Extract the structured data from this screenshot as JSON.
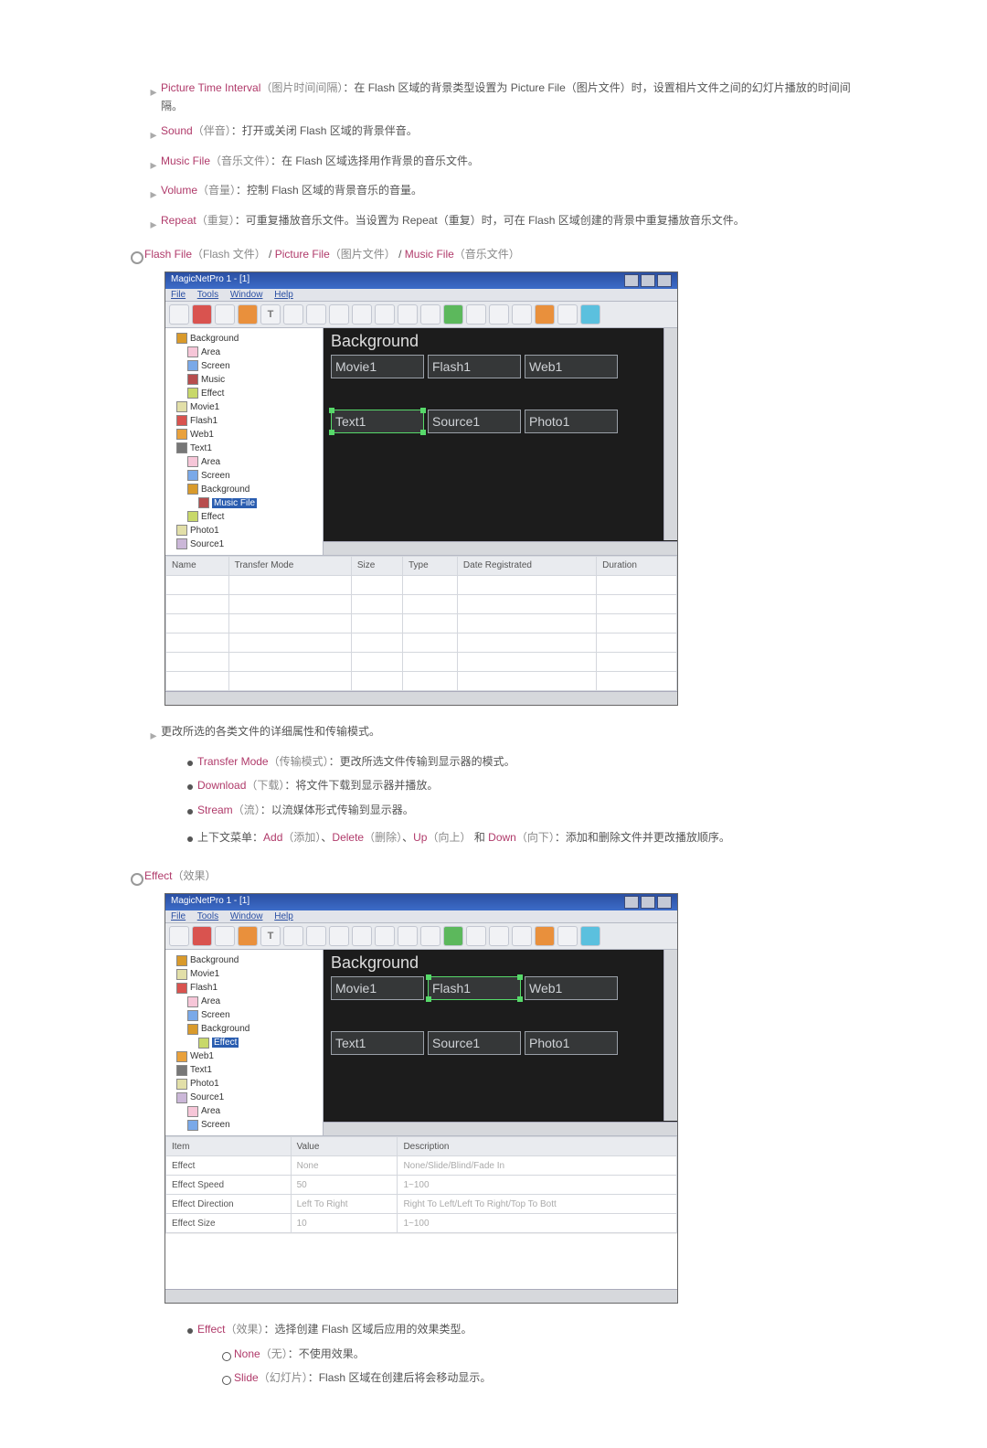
{
  "bullets": {
    "pti": {
      "term": "Picture Time Interval",
      "paren": "（图片时间间隔）",
      "text": "：在 Flash 区域的背景类型设置为 Picture File（图片文件）时，设置相片文件之间的幻灯片播放的时间间隔。"
    },
    "sound": {
      "term": "Sound",
      "paren": "（伴音）",
      "text": "：打开或关闭 Flash 区域的背景伴音。"
    },
    "music": {
      "term": "Music File",
      "paren": "（音乐文件）",
      "text": "：在 Flash 区域选择用作背景的音乐文件。"
    },
    "volume": {
      "term": "Volume",
      "paren": "（音量）",
      "text": "：控制 Flash 区域的背景音乐的音量。"
    },
    "repeat": {
      "term": "Repeat",
      "paren": "（重复）",
      "text": "：可重复播放音乐文件。当设置为 Repeat（重复）时，可在 Flash 区域创建的背景中重复播放音乐文件。"
    }
  },
  "heading1": {
    "term1": "Flash File",
    "paren1": "（Flash 文件）",
    "term2": "Picture File",
    "paren2": "（图片文件）",
    "term3": "Music File",
    "paren3": "（音乐文件）"
  },
  "shot": {
    "title": "MagicNetPro 1 - [1]",
    "menubar": [
      "File",
      "Tools",
      "Window",
      "Help"
    ],
    "tree1": [
      {
        "lvl": "d1",
        "ic": "ti-bg",
        "label": "Background"
      },
      {
        "lvl": "d2",
        "ic": "ti-area",
        "label": "Area"
      },
      {
        "lvl": "d2",
        "ic": "ti-scr",
        "label": "Screen"
      },
      {
        "lvl": "d2",
        "ic": "ti-mus",
        "label": "Music"
      },
      {
        "lvl": "d2",
        "ic": "ti-eff",
        "label": "Effect"
      },
      {
        "lvl": "d1",
        "ic": "ti-ph",
        "label": "Movie1"
      },
      {
        "lvl": "d1",
        "ic": "ti-fl",
        "label": "Flash1"
      },
      {
        "lvl": "d1",
        "ic": "ti-wb",
        "label": "Web1"
      },
      {
        "lvl": "d1",
        "ic": "ti-tx",
        "label": "Text1"
      },
      {
        "lvl": "d2",
        "ic": "ti-area",
        "label": "Area"
      },
      {
        "lvl": "d2",
        "ic": "ti-scr",
        "label": "Screen"
      },
      {
        "lvl": "d2",
        "ic": "ti-bg",
        "label": "Background"
      },
      {
        "lvl": "d3",
        "ic": "ti-mus",
        "label": "Music File",
        "sel": true
      },
      {
        "lvl": "d2",
        "ic": "ti-eff",
        "label": "Effect"
      },
      {
        "lvl": "d1",
        "ic": "ti-ph",
        "label": "Photo1"
      },
      {
        "lvl": "d1",
        "ic": "ti-sr",
        "label": "Source1"
      }
    ],
    "bg_label": "Background",
    "tiles_r1": [
      "Movie1",
      "Flash1",
      "Web1"
    ],
    "tiles_r2": [
      "Text1",
      "Source1",
      "Photo1"
    ],
    "grid1_cols": [
      "Name",
      "Transfer Mode",
      "Size",
      "Type",
      "Date Registrated",
      "Duration"
    ]
  },
  "mid": {
    "change": "更改所选的各类文件的详细属性和传输模式。",
    "tm": {
      "term": "Transfer Mode",
      "paren": "（传输模式）",
      "text": "：更改所选文件传输到显示器的模式。"
    },
    "dl": {
      "term": "Download",
      "paren": "（下载）",
      "text": "：将文件下载到显示器并播放。"
    },
    "st": {
      "term": "Stream",
      "paren": "（流）",
      "text": "：以流媒体形式传输到显示器。"
    },
    "ctx_prefix": "上下文菜单：",
    "ctx_add": "Add",
    "ctx_add_p": "（添加）",
    "ctx_del": "Delete",
    "ctx_del_p": "（删除）",
    "ctx_up": "Up",
    "ctx_up_p": "（向上）",
    "ctx_and": " 和 ",
    "ctx_down": "Down",
    "ctx_down_p": "（向下）",
    "ctx_tail": "：添加和删除文件并更改播放顺序。"
  },
  "heading2": {
    "term": "Effect",
    "paren": "（效果）"
  },
  "shot2": {
    "title": "MagicNetPro 1 - [1]",
    "tree": [
      {
        "lvl": "d1",
        "ic": "ti-bg",
        "label": "Background"
      },
      {
        "lvl": "d1",
        "ic": "ti-ph",
        "label": "Movie1"
      },
      {
        "lvl": "d1",
        "ic": "ti-fl",
        "label": "Flash1"
      },
      {
        "lvl": "d2",
        "ic": "ti-area",
        "label": "Area"
      },
      {
        "lvl": "d2",
        "ic": "ti-scr",
        "label": "Screen"
      },
      {
        "lvl": "d2",
        "ic": "ti-bg",
        "label": "Background"
      },
      {
        "lvl": "d3",
        "ic": "ti-eff",
        "label": "Effect",
        "sel": true
      },
      {
        "lvl": "d1",
        "ic": "ti-wb",
        "label": "Web1"
      },
      {
        "lvl": "d1",
        "ic": "ti-tx",
        "label": "Text1"
      },
      {
        "lvl": "d1",
        "ic": "ti-ph",
        "label": "Photo1"
      },
      {
        "lvl": "d1",
        "ic": "ti-sr",
        "label": "Source1"
      },
      {
        "lvl": "d2",
        "ic": "ti-area",
        "label": "Area"
      },
      {
        "lvl": "d2",
        "ic": "ti-scr",
        "label": "Screen"
      }
    ],
    "grid": {
      "cols": [
        "Item",
        "Value",
        "Description"
      ],
      "rows": [
        [
          "Effect",
          "None",
          "None/Slide/Blind/Fade In"
        ],
        [
          "Effect Speed",
          "50",
          "1~100"
        ],
        [
          "Effect Direction",
          "Left To Right",
          "Right To Left/Left To Right/Top To Bott"
        ],
        [
          "Effect Size",
          "10",
          "1~100"
        ]
      ]
    }
  },
  "eff": {
    "l1": {
      "term": "Effect",
      "paren": "（效果）",
      "text": "：选择创建 Flash 区域后应用的效果类型。"
    },
    "none": {
      "term": "None",
      "paren": "（无）",
      "text": "：不使用效果。"
    },
    "slide": {
      "term": "Slide",
      "paren": "（幻灯片）",
      "text": "：Flash 区域在创建后将会移动显示。"
    }
  }
}
